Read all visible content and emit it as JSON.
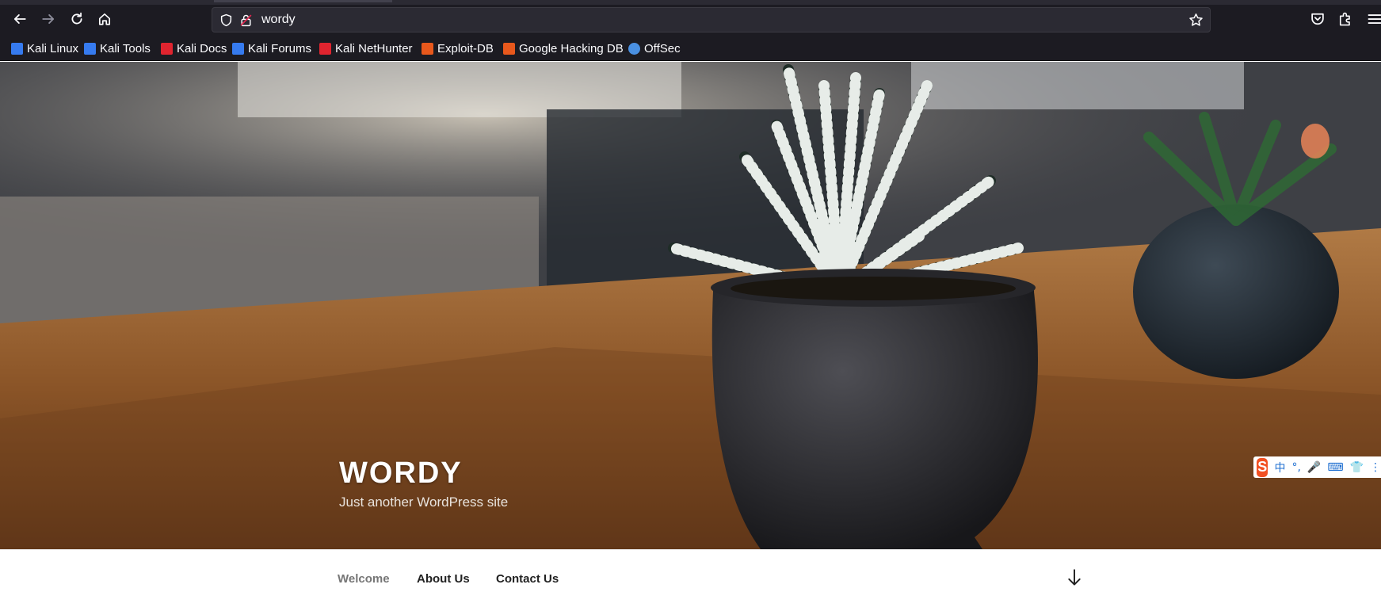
{
  "browser": {
    "url": "wordy",
    "bookmarks": [
      {
        "label": "Kali Linux",
        "color": "#367bf0"
      },
      {
        "label": "Kali Tools",
        "color": "#367bf0"
      },
      {
        "label": "Kali Docs",
        "color": "#e0242f"
      },
      {
        "label": "Kali Forums",
        "color": "#367bf0"
      },
      {
        "label": "Kali NetHunter",
        "color": "#e0242f"
      },
      {
        "label": "Exploit-DB",
        "color": "#e8581c"
      },
      {
        "label": "Google Hacking DB",
        "color": "#e8581c"
      },
      {
        "label": "OffSec",
        "color": "#4a90e2"
      }
    ]
  },
  "site": {
    "title": "WORDY",
    "description": "Just another WordPress site"
  },
  "ime": {
    "logo": "S",
    "items": [
      "中",
      "°,",
      "🎤",
      "⌨",
      "👕",
      "⋮"
    ]
  },
  "menu": {
    "items": [
      "Welcome",
      "About Us",
      "Contact Us"
    ]
  },
  "colors": {
    "toolbar_bg": "#1c1b22",
    "urlbar_bg": "#2b2a33",
    "text_light": "#fbfbfe"
  }
}
